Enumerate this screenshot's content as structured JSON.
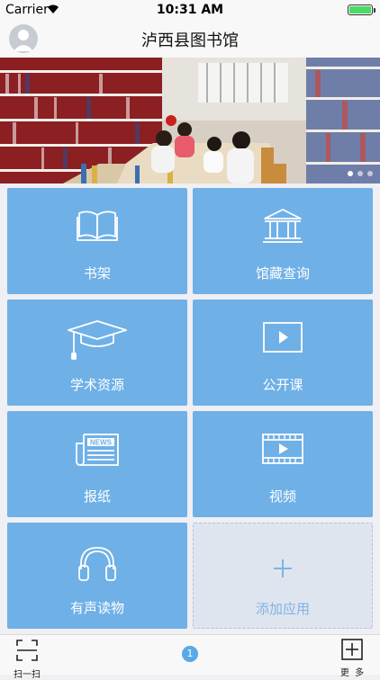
{
  "status_bar": {
    "carrier": "Carrier",
    "time": "10:31 AM",
    "battery_level": 1.0
  },
  "header": {
    "title": "泸西县图书馆",
    "avatar_icon": "user-avatar-icon"
  },
  "banner": {
    "slides": 3,
    "active_slide": 0,
    "image_alt": "library reading room"
  },
  "tiles": [
    {
      "label": "书架",
      "icon": "book-icon"
    },
    {
      "label": "馆藏查询",
      "icon": "library-building-icon"
    },
    {
      "label": "学术资源",
      "icon": "graduation-cap-icon"
    },
    {
      "label": "公开课",
      "icon": "play-screen-icon"
    },
    {
      "label": "报纸",
      "icon": "newspaper-icon",
      "icon_text": "NEWS"
    },
    {
      "label": "视频",
      "icon": "film-strip-icon"
    },
    {
      "label": "有声读物",
      "icon": "headphones-icon"
    },
    {
      "label": "添加应用",
      "icon": "plus-icon"
    }
  ],
  "tab_bar": {
    "scan_label": "扫一扫",
    "badge_count": "1",
    "more_label": "更  多"
  },
  "colors": {
    "tile": "#6fb0e7",
    "add_tile": "#dfe5ee",
    "accent": "#5aa9e6"
  }
}
